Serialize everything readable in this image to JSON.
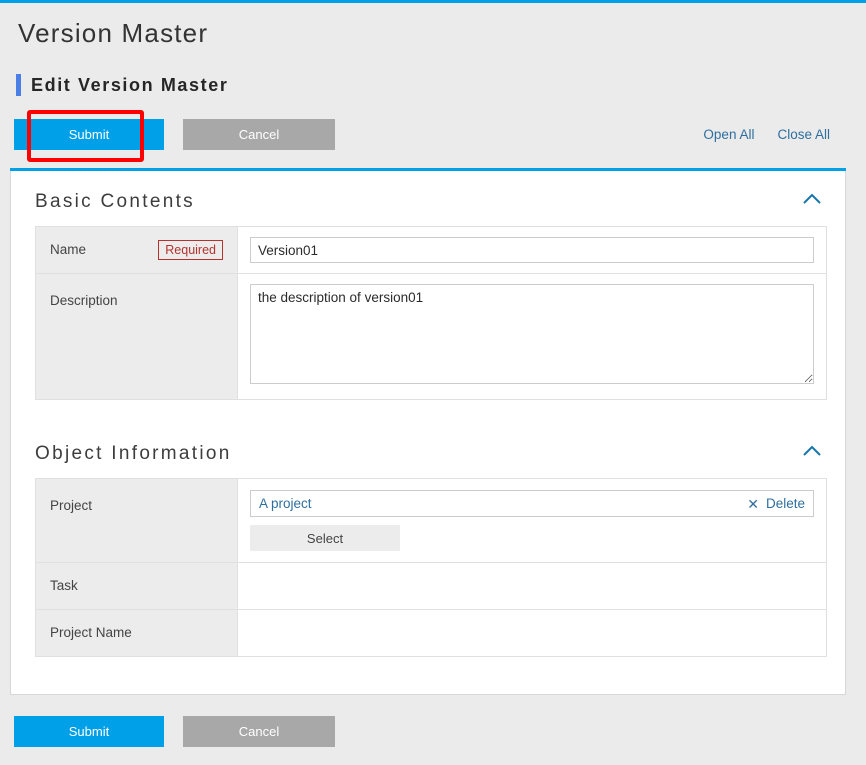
{
  "theme": {
    "accent": "#00a0e9",
    "link": "#2f6f9f",
    "required": "#b5332c",
    "secondary_button": "#a8a8a8",
    "highlight": "#ff0000",
    "page_background": "#ebebeb",
    "subheader_bar": "#4a7fe8"
  },
  "header": {
    "page_title": "Version Master",
    "sub_title": "Edit Version Master"
  },
  "toolbar": {
    "submit_label": "Submit",
    "cancel_label": "Cancel",
    "open_all_label": "Open All",
    "close_all_label": "Close All"
  },
  "footer": {
    "submit_label": "Submit",
    "cancel_label": "Cancel"
  },
  "sections": [
    {
      "title": "Basic Contents",
      "collapse_icon": "chevron-up-icon",
      "rows": [
        {
          "label": "Name",
          "badge": "Required",
          "field_type": "text",
          "value": "Version01",
          "placeholder": ""
        },
        {
          "label": "Description",
          "badge": "",
          "field_type": "textarea",
          "value": "the description of version01",
          "placeholder": ""
        }
      ]
    },
    {
      "title": "Object Information",
      "collapse_icon": "chevron-up-icon",
      "rows": [
        {
          "label": "Project",
          "badge": "",
          "field_type": "reference",
          "value": "A project",
          "delete_icon": "close-x-icon",
          "delete_label": "Delete",
          "select_label": "Select"
        },
        {
          "label": "Task",
          "badge": "",
          "field_type": "empty",
          "value": ""
        },
        {
          "label": "Project Name",
          "badge": "",
          "field_type": "empty",
          "value": ""
        }
      ]
    }
  ]
}
